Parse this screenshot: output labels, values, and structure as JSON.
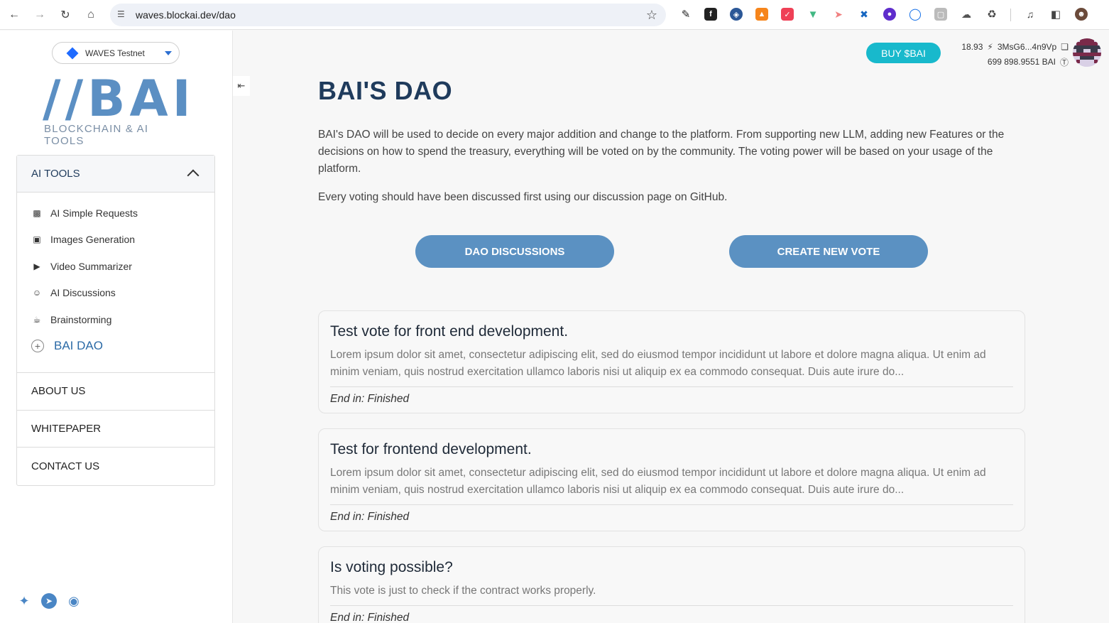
{
  "browser": {
    "url": "waves.blockai.dev/dao"
  },
  "sidebar": {
    "network": "WAVES Testnet",
    "logo_mark": "//BAI",
    "logo_sub": "BLOCKCHAIN & AI TOOLS",
    "section_title": "AI TOOLS",
    "items": [
      {
        "label": "AI Simple Requests",
        "icon": "robot-icon"
      },
      {
        "label": "Images Generation",
        "icon": "image-icon"
      },
      {
        "label": "Video Summarizer",
        "icon": "video-icon"
      },
      {
        "label": "AI Discussions",
        "icon": "chat-icon"
      },
      {
        "label": "Brainstorming",
        "icon": "coffee-icon"
      },
      {
        "label": "BAI DAO",
        "icon": "plus-circle-icon"
      }
    ],
    "links": [
      "ABOUT US",
      "WHITEPAPER",
      "CONTACT US"
    ]
  },
  "header": {
    "buy_label": "BUY $BAI",
    "balance_waves": "18.93",
    "address": "3MsG6...4n9Vp",
    "balance_bai": "699 898.9551 BAI"
  },
  "main": {
    "title": "BAI'S DAO",
    "intro": "BAI's DAO will be used to decide on every major addition and change to the platform. From supporting new LLM, adding new Features or the decisions on how to spend the treasury, everything will be voted on by the community. The voting power will be based on your usage of the platform.",
    "intro2": "Every voting should have been discussed first using our discussion page on GitHub.",
    "btn_discussions": "DAO DISCUSSIONS",
    "btn_create": "CREATE NEW VOTE",
    "votes": [
      {
        "title": "Test vote for front end development.",
        "desc": "Lorem ipsum dolor sit amet, consectetur adipiscing elit, sed do eiusmod tempor incididunt ut labore et dolore magna aliqua. Ut enim ad minim veniam, quis nostrud exercitation ullamco laboris nisi ut aliquip ex ea commodo consequat. Duis aute irure do...",
        "end": "End in: Finished"
      },
      {
        "title": "Test for frontend development.",
        "desc": "Lorem ipsum dolor sit amet, consectetur adipiscing elit, sed do eiusmod tempor incididunt ut labore et dolore magna aliqua. Ut enim ad minim veniam, quis nostrud exercitation ullamco laboris nisi ut aliquip ex ea commodo consequat. Duis aute irure do...",
        "end": "End in: Finished"
      },
      {
        "title": "Is voting possible?",
        "desc": "This vote is just to check if the contract works properly.",
        "end": "End in: Finished"
      }
    ]
  },
  "colors": {
    "accent": "#5b91c2",
    "buy": "#18b9cc",
    "title": "#1f3b5c"
  }
}
